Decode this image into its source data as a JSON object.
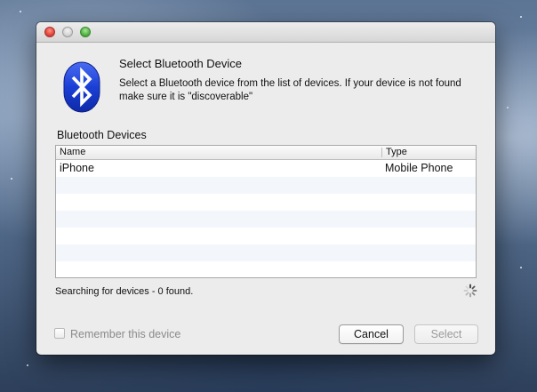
{
  "window": {
    "heading": "Select Bluetooth Device",
    "description": "Select a Bluetooth device from the list of devices. If your device is not found make sure it is \"discoverable\""
  },
  "devices": {
    "section_label": "Bluetooth Devices",
    "columns": {
      "name": "Name",
      "type": "Type"
    },
    "rows": [
      {
        "name": "iPhone",
        "type": "Mobile Phone"
      }
    ]
  },
  "status": {
    "text": "Searching for devices - 0 found."
  },
  "footer": {
    "remember_label": "Remember this device",
    "remember_checked": false,
    "cancel_label": "Cancel",
    "select_label": "Select"
  },
  "icons": {
    "app_icon": "bluetooth-icon",
    "spinner": "progress-spinner-icon"
  },
  "colors": {
    "bluetooth_blue": "#1b3fd6"
  }
}
